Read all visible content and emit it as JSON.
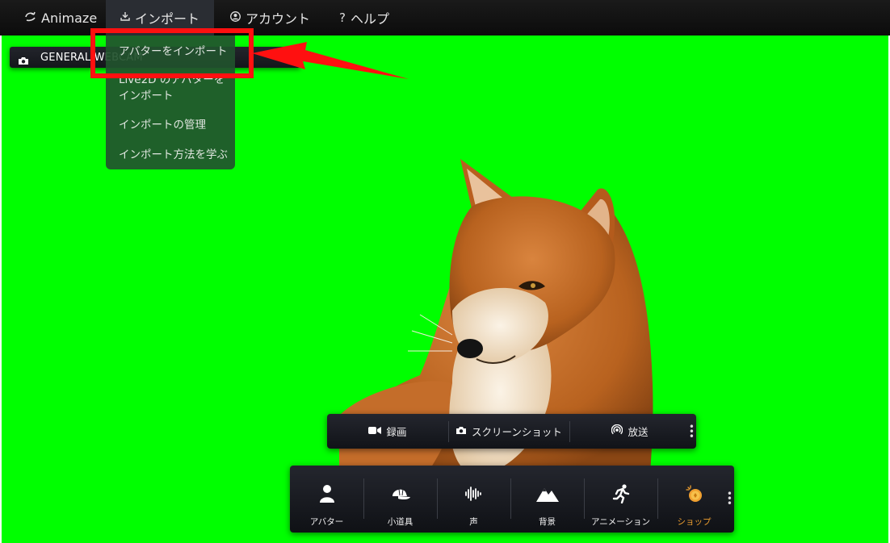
{
  "menubar": {
    "items": [
      {
        "label": "Animaze",
        "icon": "animaze-logo-icon"
      },
      {
        "label": "インポート",
        "icon": "import-icon"
      },
      {
        "label": "アカウント",
        "icon": "account-icon"
      },
      {
        "label": "ヘルプ",
        "icon": "help-icon",
        "glyph": "?"
      }
    ]
  },
  "webcam": {
    "label": "GENERAL WEBCAM"
  },
  "import_menu": {
    "items": [
      {
        "label": "アバターをインポート"
      },
      {
        "label": "Live2D のアバターをインポート"
      },
      {
        "label": "インポートの管理"
      },
      {
        "label": "インポート方法を学ぶ"
      }
    ]
  },
  "record_bar": {
    "items": [
      {
        "label": "録画",
        "icon": "video-camera-icon"
      },
      {
        "label": "スクリーンショット",
        "icon": "camera-icon"
      },
      {
        "label": "放送",
        "icon": "broadcast-icon"
      }
    ]
  },
  "toolbar": {
    "items": [
      {
        "label": "アバター",
        "icon": "person-icon"
      },
      {
        "label": "小道具",
        "icon": "cap-icon"
      },
      {
        "label": "声",
        "icon": "soundwave-icon"
      },
      {
        "label": "背景",
        "icon": "mountain-icon"
      },
      {
        "label": "アニメーション",
        "icon": "running-icon"
      },
      {
        "label": "ショップ",
        "icon": "coin-icon"
      }
    ]
  },
  "colors": {
    "stage": "#00ff00",
    "highlight": "#ff1010",
    "shop_accent": "#f0a030",
    "dropdown": "#22522e"
  }
}
